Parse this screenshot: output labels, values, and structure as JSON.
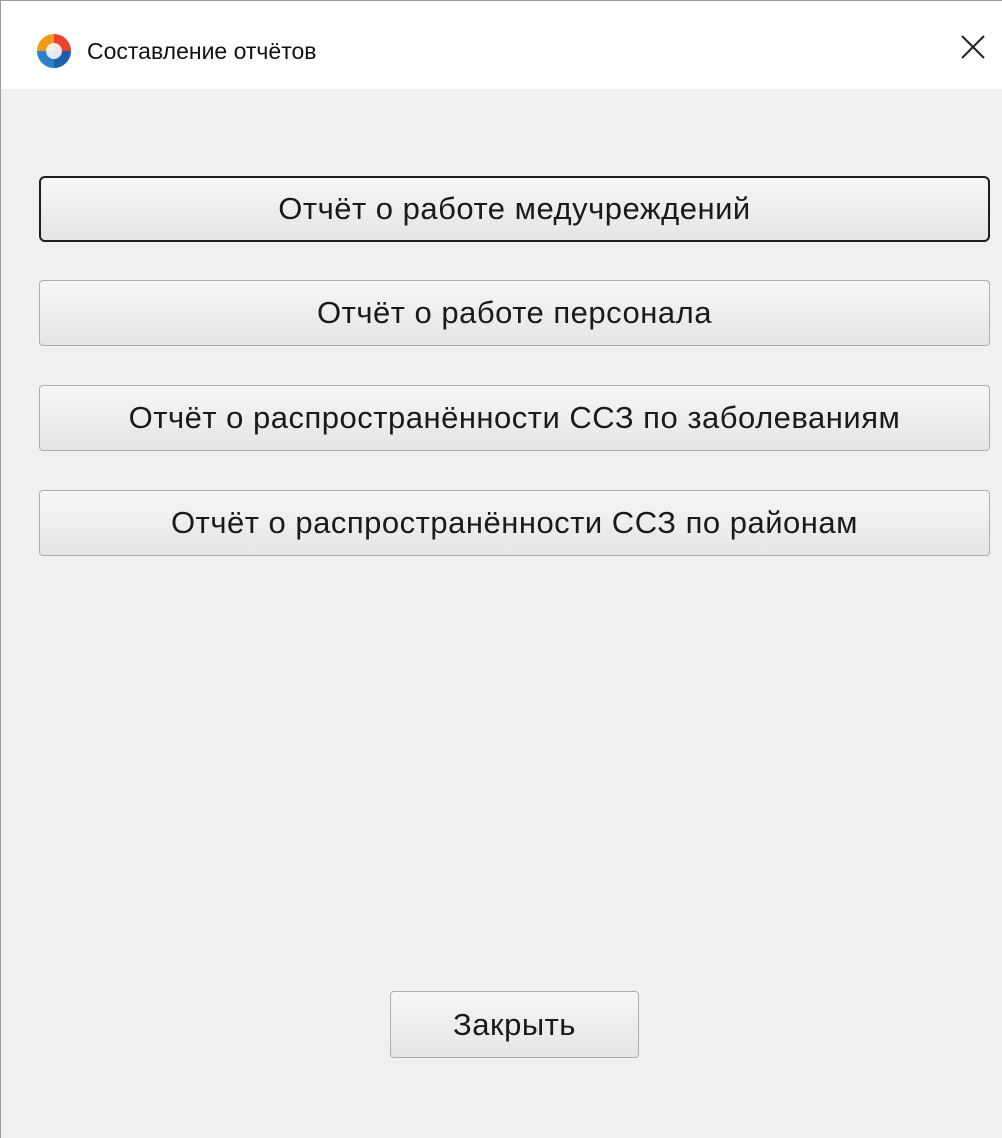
{
  "window": {
    "title": "Составление отчётов",
    "icon": "app-logo-icon",
    "close_icon": "close-icon"
  },
  "buttons": {
    "report_facilities": "Отчёт о работе медучреждений",
    "report_staff": "Отчёт о работе персонала",
    "report_diseases": "Отчёт о распространённости ССЗ по заболеваниям",
    "report_districts": "Отчёт о распространённости ССЗ по районам",
    "close": "Закрыть"
  },
  "colors": {
    "window_bg": "#f0f0f0",
    "titlebar_bg": "#ffffff",
    "button_border": "#adadad",
    "default_button_border": "#1e1e1e"
  }
}
